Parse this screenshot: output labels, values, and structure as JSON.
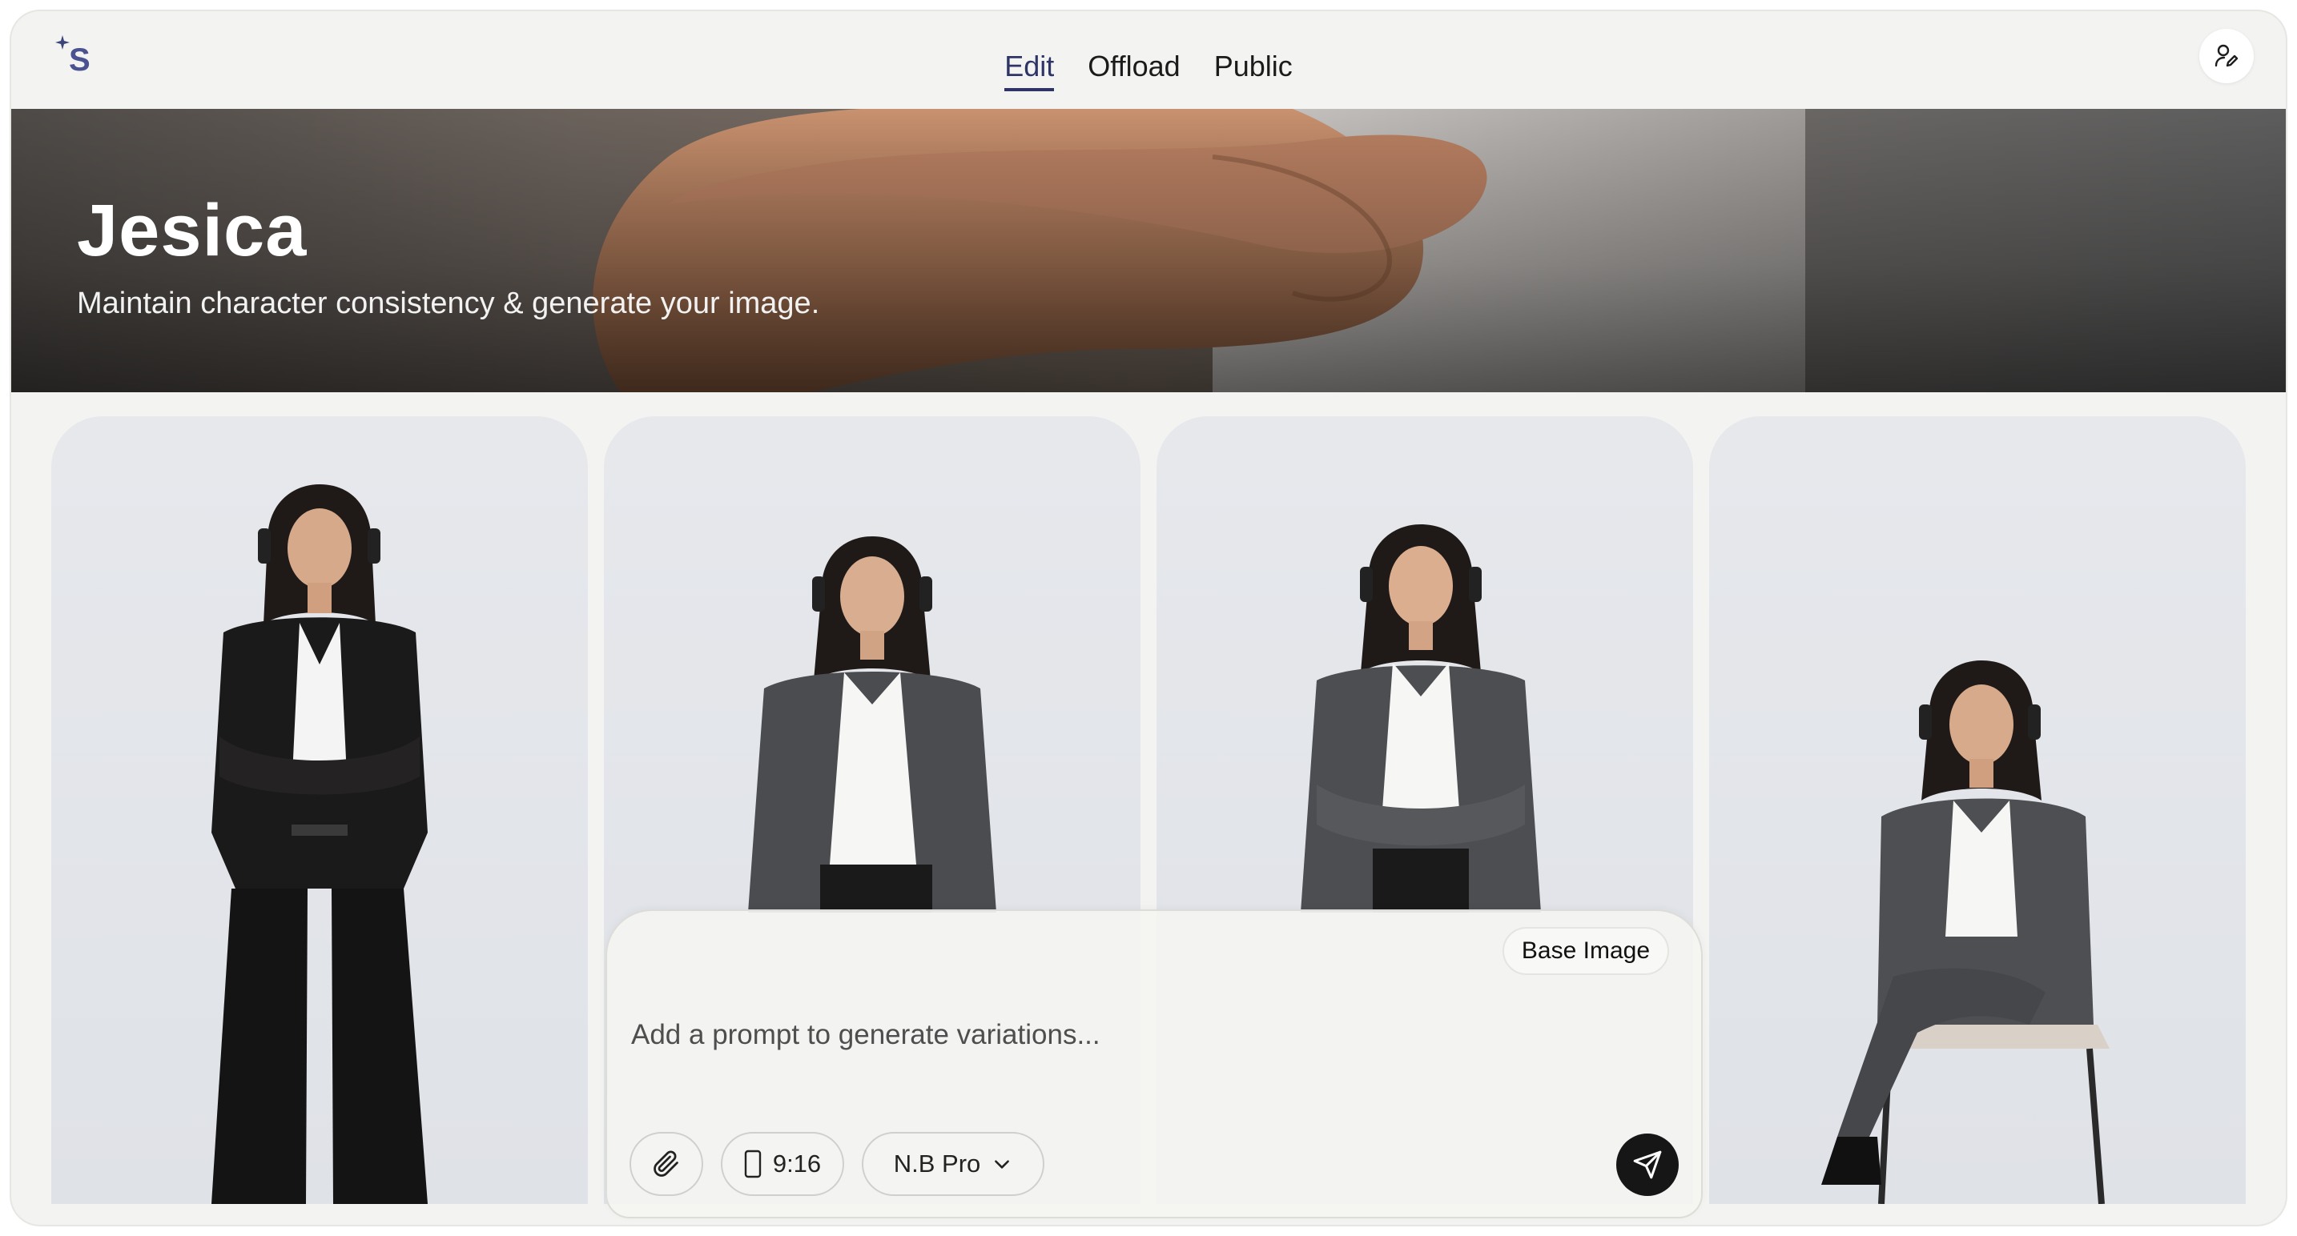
{
  "nav": {
    "tabs": [
      {
        "label": "Edit",
        "active": true
      },
      {
        "label": "Offload",
        "active": false
      },
      {
        "label": "Public",
        "active": false
      }
    ],
    "logo_icon": "sparkle-s-logo",
    "user_icon": "user-edit-icon"
  },
  "banner": {
    "title": "Jesica",
    "subtitle": "Maintain character consistency & generate your image."
  },
  "gallery": {
    "images": [
      {
        "description": "woman-black-suit-arms-crossed-full-body"
      },
      {
        "description": "woman-grey-blazer-hands-in-pockets"
      },
      {
        "description": "woman-grey-blazer-arms-crossed"
      },
      {
        "description": "woman-grey-suit-seated-on-chair"
      }
    ]
  },
  "composer": {
    "base_chip": "Base Image",
    "placeholder": "Add a prompt to generate variations...",
    "value": "",
    "aspect_ratio": "9:16",
    "model": "N.B Pro",
    "attach_icon": "paperclip-icon",
    "aspect_icon": "phone-portrait-icon",
    "dropdown_icon": "chevron-down-icon",
    "send_icon": "send-arrow-icon"
  },
  "colors": {
    "accent": "#2e3566",
    "background": "#f3f3f1",
    "send_button": "#161616"
  }
}
